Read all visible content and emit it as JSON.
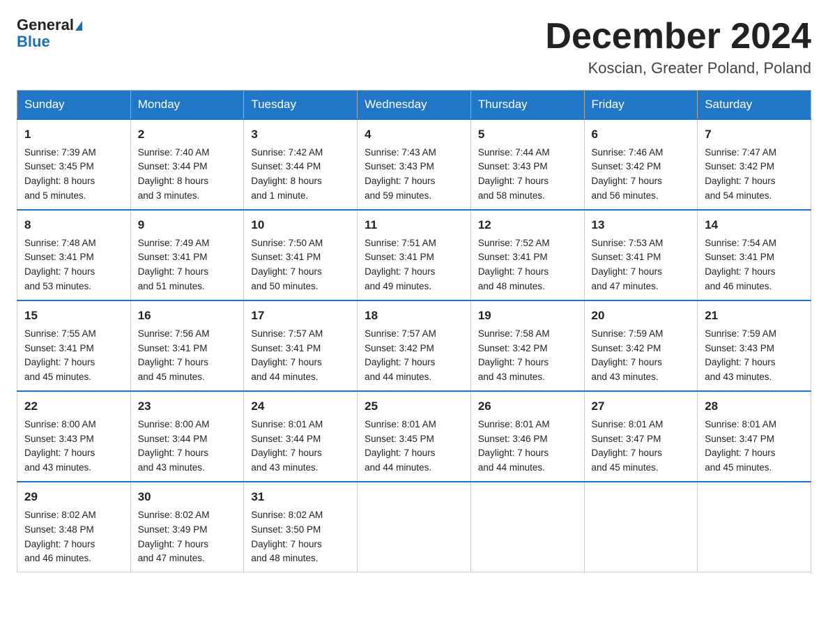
{
  "header": {
    "logo_general": "General",
    "logo_blue": "Blue",
    "title": "December 2024",
    "subtitle": "Koscian, Greater Poland, Poland"
  },
  "columns": [
    "Sunday",
    "Monday",
    "Tuesday",
    "Wednesday",
    "Thursday",
    "Friday",
    "Saturday"
  ],
  "weeks": [
    [
      {
        "day": "1",
        "sunrise": "7:39 AM",
        "sunset": "3:45 PM",
        "daylight": "8 hours and 5 minutes."
      },
      {
        "day": "2",
        "sunrise": "7:40 AM",
        "sunset": "3:44 PM",
        "daylight": "8 hours and 3 minutes."
      },
      {
        "day": "3",
        "sunrise": "7:42 AM",
        "sunset": "3:44 PM",
        "daylight": "8 hours and 1 minute."
      },
      {
        "day": "4",
        "sunrise": "7:43 AM",
        "sunset": "3:43 PM",
        "daylight": "7 hours and 59 minutes."
      },
      {
        "day": "5",
        "sunrise": "7:44 AM",
        "sunset": "3:43 PM",
        "daylight": "7 hours and 58 minutes."
      },
      {
        "day": "6",
        "sunrise": "7:46 AM",
        "sunset": "3:42 PM",
        "daylight": "7 hours and 56 minutes."
      },
      {
        "day": "7",
        "sunrise": "7:47 AM",
        "sunset": "3:42 PM",
        "daylight": "7 hours and 54 minutes."
      }
    ],
    [
      {
        "day": "8",
        "sunrise": "7:48 AM",
        "sunset": "3:41 PM",
        "daylight": "7 hours and 53 minutes."
      },
      {
        "day": "9",
        "sunrise": "7:49 AM",
        "sunset": "3:41 PM",
        "daylight": "7 hours and 51 minutes."
      },
      {
        "day": "10",
        "sunrise": "7:50 AM",
        "sunset": "3:41 PM",
        "daylight": "7 hours and 50 minutes."
      },
      {
        "day": "11",
        "sunrise": "7:51 AM",
        "sunset": "3:41 PM",
        "daylight": "7 hours and 49 minutes."
      },
      {
        "day": "12",
        "sunrise": "7:52 AM",
        "sunset": "3:41 PM",
        "daylight": "7 hours and 48 minutes."
      },
      {
        "day": "13",
        "sunrise": "7:53 AM",
        "sunset": "3:41 PM",
        "daylight": "7 hours and 47 minutes."
      },
      {
        "day": "14",
        "sunrise": "7:54 AM",
        "sunset": "3:41 PM",
        "daylight": "7 hours and 46 minutes."
      }
    ],
    [
      {
        "day": "15",
        "sunrise": "7:55 AM",
        "sunset": "3:41 PM",
        "daylight": "7 hours and 45 minutes."
      },
      {
        "day": "16",
        "sunrise": "7:56 AM",
        "sunset": "3:41 PM",
        "daylight": "7 hours and 45 minutes."
      },
      {
        "day": "17",
        "sunrise": "7:57 AM",
        "sunset": "3:41 PM",
        "daylight": "7 hours and 44 minutes."
      },
      {
        "day": "18",
        "sunrise": "7:57 AM",
        "sunset": "3:42 PM",
        "daylight": "7 hours and 44 minutes."
      },
      {
        "day": "19",
        "sunrise": "7:58 AM",
        "sunset": "3:42 PM",
        "daylight": "7 hours and 43 minutes."
      },
      {
        "day": "20",
        "sunrise": "7:59 AM",
        "sunset": "3:42 PM",
        "daylight": "7 hours and 43 minutes."
      },
      {
        "day": "21",
        "sunrise": "7:59 AM",
        "sunset": "3:43 PM",
        "daylight": "7 hours and 43 minutes."
      }
    ],
    [
      {
        "day": "22",
        "sunrise": "8:00 AM",
        "sunset": "3:43 PM",
        "daylight": "7 hours and 43 minutes."
      },
      {
        "day": "23",
        "sunrise": "8:00 AM",
        "sunset": "3:44 PM",
        "daylight": "7 hours and 43 minutes."
      },
      {
        "day": "24",
        "sunrise": "8:01 AM",
        "sunset": "3:44 PM",
        "daylight": "7 hours and 43 minutes."
      },
      {
        "day": "25",
        "sunrise": "8:01 AM",
        "sunset": "3:45 PM",
        "daylight": "7 hours and 44 minutes."
      },
      {
        "day": "26",
        "sunrise": "8:01 AM",
        "sunset": "3:46 PM",
        "daylight": "7 hours and 44 minutes."
      },
      {
        "day": "27",
        "sunrise": "8:01 AM",
        "sunset": "3:47 PM",
        "daylight": "7 hours and 45 minutes."
      },
      {
        "day": "28",
        "sunrise": "8:01 AM",
        "sunset": "3:47 PM",
        "daylight": "7 hours and 45 minutes."
      }
    ],
    [
      {
        "day": "29",
        "sunrise": "8:02 AM",
        "sunset": "3:48 PM",
        "daylight": "7 hours and 46 minutes."
      },
      {
        "day": "30",
        "sunrise": "8:02 AM",
        "sunset": "3:49 PM",
        "daylight": "7 hours and 47 minutes."
      },
      {
        "day": "31",
        "sunrise": "8:02 AM",
        "sunset": "3:50 PM",
        "daylight": "7 hours and 48 minutes."
      },
      null,
      null,
      null,
      null
    ]
  ],
  "labels": {
    "sunrise": "Sunrise: ",
    "sunset": "Sunset: ",
    "daylight": "Daylight: "
  }
}
